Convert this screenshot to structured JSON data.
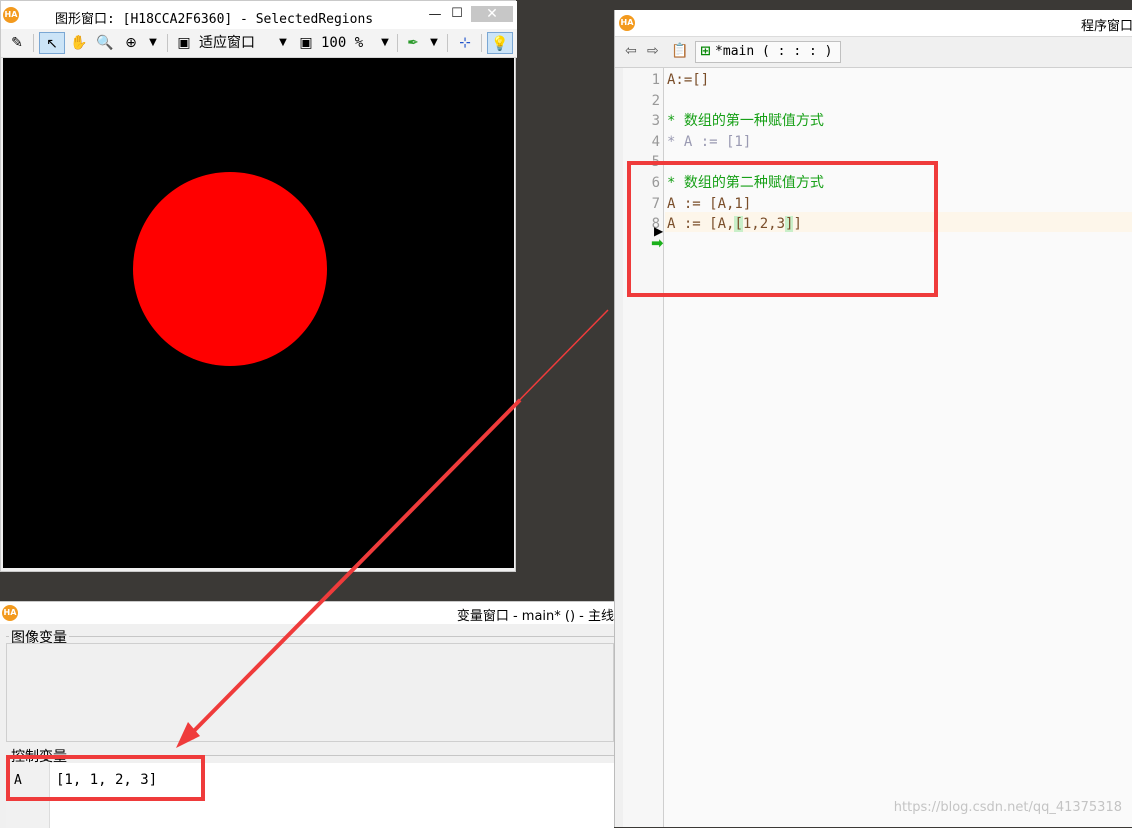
{
  "graphics_window": {
    "title": "图形窗口: [H18CCA2F6360] - SelectedRegions",
    "close_glyph": "✕",
    "fit_window_label": "适应窗口",
    "zoom_label": "100 %",
    "region": {
      "shape": "circle",
      "fill": "#ff0000",
      "background": "#000000"
    }
  },
  "program_window": {
    "title": "程序窗口",
    "tab_label": "*main ( : : : )",
    "lines": [
      {
        "num": "1",
        "text": "A:=[]",
        "style": "normal"
      },
      {
        "num": "2",
        "text": "",
        "style": "normal"
      },
      {
        "num": "3",
        "text": "* 数组的第一种赋值方式",
        "style": "comment"
      },
      {
        "num": "4",
        "text": "* A := [1]",
        "style": "disabled"
      },
      {
        "num": "5",
        "text": "",
        "style": "normal"
      },
      {
        "num": "6",
        "text": "* 数组的第二种赋值方式",
        "style": "comment"
      },
      {
        "num": "7",
        "text": "A := [A,1]",
        "style": "normal"
      },
      {
        "num": "8",
        "pre": "A := [A,",
        "bracket_open": "[",
        "mid": "1,2,3",
        "bracket_close": "]",
        "post": "]",
        "style": "normal"
      }
    ]
  },
  "variable_window": {
    "title": "变量窗口 - main* () - 主线",
    "image_vars_label": "图像变量",
    "control_vars_label": "控制变量",
    "control_vars": [
      {
        "name": "A",
        "value": "[1, 1, 2, 3]"
      }
    ]
  },
  "watermark": "https://blog.csdn.net/qq_41375318",
  "colors": {
    "annotation_red": "#ef3b3b",
    "comment_green": "#17a017",
    "logo_orange": "#f39a1e",
    "desktop": "#3b3936"
  }
}
